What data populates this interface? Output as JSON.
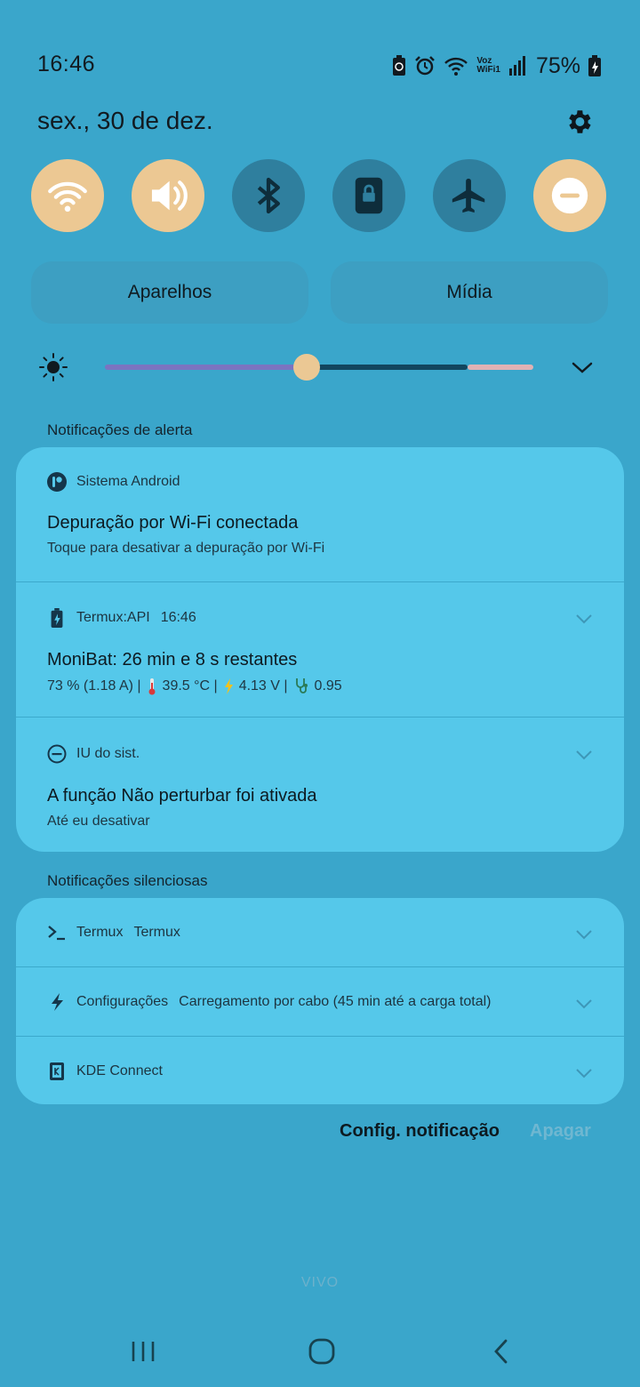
{
  "status_bar": {
    "time": "16:46",
    "voz_label": "Voz",
    "wifi_label": "WiFi1",
    "battery_percent": "75%",
    "icons": [
      "battery-saver-icon",
      "alarm-icon",
      "wifi-icon",
      "vowifi-icon",
      "signal-icon",
      "battery-charging-icon"
    ]
  },
  "header": {
    "date": "sex., 30 de dez."
  },
  "quick_toggles": [
    {
      "icon": "wifi-icon",
      "state": "on"
    },
    {
      "icon": "sound-icon",
      "state": "on"
    },
    {
      "icon": "bluetooth-icon",
      "state": "off"
    },
    {
      "icon": "rotation-lock-icon",
      "state": "off"
    },
    {
      "icon": "airplane-icon",
      "state": "off"
    },
    {
      "icon": "do-not-disturb-icon",
      "state": "on"
    }
  ],
  "panels": {
    "devices_label": "Aparelhos",
    "media_label": "Mídia"
  },
  "brightness": {
    "level": 0.47
  },
  "alert_section": {
    "title": "Notificações de alerta",
    "notifications": [
      {
        "app": "Sistema Android",
        "title": "Depuração por Wi-Fi conectada",
        "body": "Toque para desativar a depuração por Wi-Fi"
      },
      {
        "app": "Termux:API",
        "time": "16:46",
        "title": "MoniBat: 26 min e 8 s restantes",
        "body_current": "73 % (1.18 A) |",
        "body_temp": "39.5 °C |",
        "body_volt": "4.13 V |",
        "body_health": "0.95"
      },
      {
        "app": "IU do sist.",
        "title": "A função Não perturbar foi ativada",
        "body": "Até eu desativar"
      }
    ]
  },
  "silent_section": {
    "title": "Notificações silenciosas",
    "notifications": [
      {
        "app": "Termux",
        "text": "Termux"
      },
      {
        "app": "Configurações",
        "text": "Carregamento por cabo (45 min até a carga total)"
      },
      {
        "app": "KDE Connect",
        "text": ""
      }
    ]
  },
  "actions": {
    "settings_label": "Config. notificação",
    "clear_label": "Apagar"
  },
  "carrier": "VIVO",
  "colors": {
    "background": "#3aa6cb",
    "card": "#55c8ea",
    "toggle_on": "#ecc893",
    "toggle_off": "#2f7f9e"
  }
}
